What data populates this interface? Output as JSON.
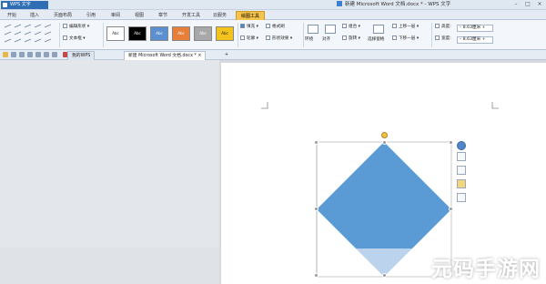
{
  "app": {
    "name": "WPS 文字",
    "window_title": "新建 Microsoft Word 文档.docx * - WPS 文字"
  },
  "menu_tabs": [
    "开始",
    "插入",
    "页面布局",
    "引用",
    "审阅",
    "视图",
    "章节",
    "开发工具",
    "云服务",
    "绘图工具"
  ],
  "active_tab": "绘图工具",
  "ribbon": {
    "edit_shape": "编辑形状",
    "textbox": "文本框",
    "style_swatches": [
      {
        "label": "Abc",
        "bg": "#ffffff",
        "fg": "#222222"
      },
      {
        "label": "Abc",
        "bg": "#000000",
        "fg": "#ffffff"
      },
      {
        "label": "Abc",
        "bg": "#5b8fd0",
        "fg": "#ffffff"
      },
      {
        "label": "Abc",
        "bg": "#e77e3a",
        "fg": "#ffffff"
      },
      {
        "label": "Abc",
        "bg": "#a8a8a8",
        "fg": "#ffffff"
      },
      {
        "label": "Abc",
        "bg": "#f2c21d",
        "fg": "#222222"
      }
    ],
    "fill": "填充",
    "format_painter": "格式刷",
    "outline": "轮廓",
    "shape_effects": "形状效果",
    "wrap": "环绕",
    "align": "对齐",
    "group": "组合",
    "rotate": "旋转",
    "selection_pane": "选择窗格",
    "bring_forward": "上移一层",
    "send_backward": "下移一层",
    "height_label": "高度:",
    "height_value": "8.63厘米",
    "width_label": "宽度:",
    "width_value": "8.63厘米"
  },
  "doc_tabs": [
    {
      "label": "我的WPS",
      "active": false
    },
    {
      "label": "新建 Microsoft Word 文档.docx *",
      "active": true
    }
  ],
  "new_tab_symbol": "+",
  "shape": {
    "type": "diamond",
    "fill": "#5b9bd5",
    "partial_fill": "#bcd3ee"
  },
  "watermark": "元码手游网"
}
